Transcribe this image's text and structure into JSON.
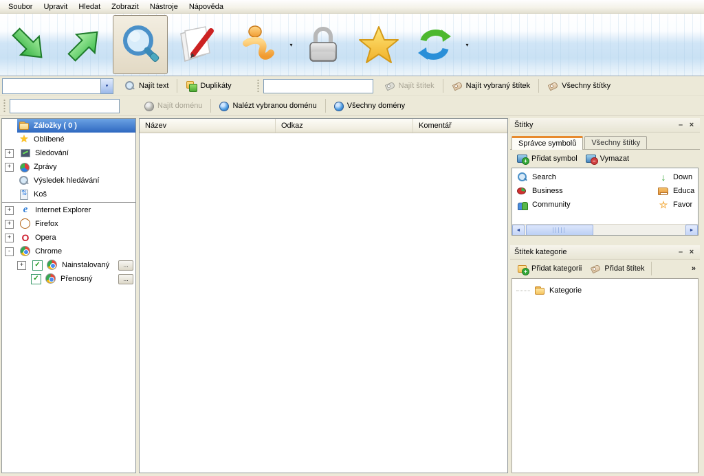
{
  "colors": {
    "window_beige": "#ece9d8",
    "toolbar_blue": "#cfe5f6",
    "selection_blue": "#2e68c0",
    "tab_accent_orange": "#e78a2e",
    "field_border": "#7f9db9"
  },
  "glyphs": {
    "minimize": "–",
    "close": "×",
    "dropdown": "▾",
    "chevron": "»",
    "scroll_left": "◄",
    "scroll_right": "►",
    "check": "✓",
    "ellipsis": "...",
    "star": "★",
    "open_star": "☆",
    "down_arrow": "↓",
    "ie_letter": "e",
    "opera_letter": "O"
  },
  "menu": {
    "items": [
      "Soubor",
      "Upravit",
      "Hledat",
      "Zobrazit",
      "Nástroje",
      "Nápověda"
    ]
  },
  "toolbar": {
    "icons": [
      "green-arrow-down-icon",
      "green-arrow-up-icon",
      "magnifier-icon",
      "edit-document-icon",
      "info-swoosh-icon",
      "lock-icon",
      "favorites-star-icon",
      "refresh-icon"
    ],
    "pressed_button": "search"
  },
  "filter_bar": {
    "search_combo_value": "",
    "find_text": "Najít text",
    "duplicates": "Duplikáty",
    "tag_field_value": "",
    "find_tag": "Najít štítek",
    "find_selected_tag": "Najít vybraný štítek",
    "all_tags": "Všechny štítky"
  },
  "domain_bar": {
    "domain_field_value": "",
    "find_domain": "Najít doménu",
    "find_selected_domain": "Nalézt vybranou doménu",
    "all_domains": "Všechny domény"
  },
  "tree": {
    "items": [
      {
        "label": "Záložky ( 0 )",
        "icon": "folder-icon",
        "selected": true
      },
      {
        "label": "Oblíbené",
        "icon": "star-icon"
      },
      {
        "label": "Sledování",
        "icon": "monitor-icon",
        "expander": "+"
      },
      {
        "label": "Zprávy",
        "icon": "pie-chart-icon",
        "expander": "+"
      },
      {
        "label": "Výsledek hledávání",
        "icon": "search-icon"
      },
      {
        "label": "Koš",
        "icon": "recycle-icon"
      },
      {
        "label": "Internet Explorer",
        "icon": "ie-icon",
        "expander": "+"
      },
      {
        "label": "Firefox",
        "icon": "firefox-icon",
        "expander": "+"
      },
      {
        "label": "Opera",
        "icon": "opera-icon",
        "expander": "+"
      },
      {
        "label": "Chrome",
        "icon": "chrome-icon",
        "expander": "-"
      },
      {
        "label": "Nainstalovaný",
        "icon": "chrome-icon",
        "expander": "+",
        "checked": true
      },
      {
        "label": "Přenosný",
        "icon": "chrome-icon",
        "checked": true
      }
    ]
  },
  "list": {
    "columns": [
      "Název",
      "Odkaz",
      "Komentář"
    ],
    "rows": []
  },
  "tags_panel": {
    "title": "Štítky",
    "tabs": [
      "Správce symbolů",
      "Všechny štítky"
    ],
    "active_tab": "Správce symbolů",
    "add_symbol": "Přidat symbol",
    "clear": "Vymazat",
    "symbols": {
      "left": [
        {
          "label": "Search",
          "icon": "search-icon"
        },
        {
          "label": "Business",
          "icon": "business-pie-icon"
        },
        {
          "label": "Community",
          "icon": "people-icon"
        }
      ],
      "right": [
        {
          "label": "Down",
          "icon": "download-arrow-icon"
        },
        {
          "label": "Educa",
          "icon": "education-book-icon"
        },
        {
          "label": "Favor",
          "icon": "favorites-star-icon"
        }
      ]
    }
  },
  "category_panel": {
    "title": "Štítek kategorie",
    "add_category": "Přidat kategorii",
    "add_tag": "Přidat štítek",
    "root_label": "Kategorie"
  }
}
